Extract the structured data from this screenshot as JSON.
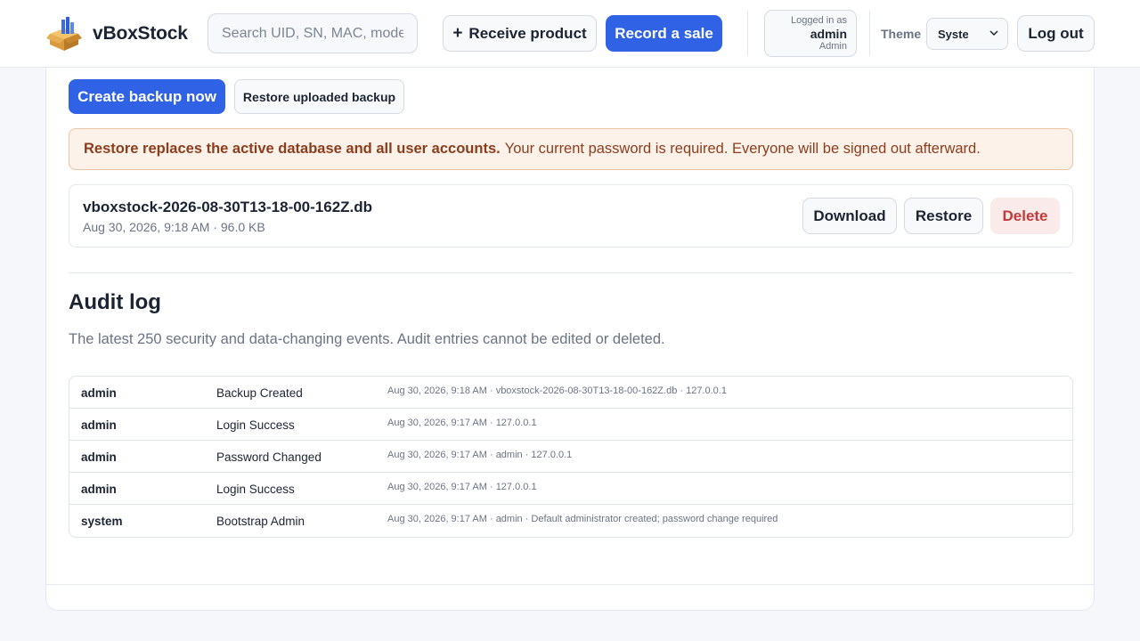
{
  "header": {
    "app_name": "vBoxStock",
    "search": {
      "placeholder": "Search UID, SN, MAC, model",
      "value": ""
    },
    "receive_label": "Receive product",
    "sale_label": "Record a sale",
    "user": {
      "logged_in_label": "Logged in as",
      "name": "admin",
      "role": "Admin"
    },
    "theme": {
      "label": "Theme",
      "selected": "System"
    },
    "logout_label": "Log out"
  },
  "backups": {
    "create_label": "Create backup now",
    "restore_uploaded_label": "Restore uploaded backup",
    "warning_bold": "Restore replaces the active database and all user accounts.",
    "warning_text": "Your current password is required. Everyone will be signed out afterward.",
    "items": [
      {
        "name": "vboxstock-2026-08-30T13-18-00-162Z.db",
        "meta": "Aug 30, 2026, 9:18 AM · 96.0 KB",
        "download_label": "Download",
        "restore_label": "Restore",
        "delete_label": "Delete"
      }
    ]
  },
  "audit": {
    "title": "Audit log",
    "description": "The latest 250 security and data-changing events. Audit entries cannot be edited or deleted.",
    "rows": [
      {
        "user": "admin",
        "action": "Backup Created",
        "details": "Aug 30, 2026, 9:18 AM · vboxstock-2026-08-30T13-18-00-162Z.db · 127.0.0.1"
      },
      {
        "user": "admin",
        "action": "Login Success",
        "details": "Aug 30, 2026, 9:17 AM · 127.0.0.1"
      },
      {
        "user": "admin",
        "action": "Password Changed",
        "details": "Aug 30, 2026, 9:17 AM · admin · 127.0.0.1"
      },
      {
        "user": "admin",
        "action": "Login Success",
        "details": "Aug 30, 2026, 9:17 AM · 127.0.0.1"
      },
      {
        "user": "system",
        "action": "Bootstrap Admin",
        "details": "Aug 30, 2026, 9:17 AM · admin · Default administrator created; password change required"
      }
    ]
  },
  "colors": {
    "primary": "#2f62e4",
    "danger": "#c23b3b",
    "warning_bg": "#fdf2ea",
    "warning_text": "#8c3d1c"
  }
}
